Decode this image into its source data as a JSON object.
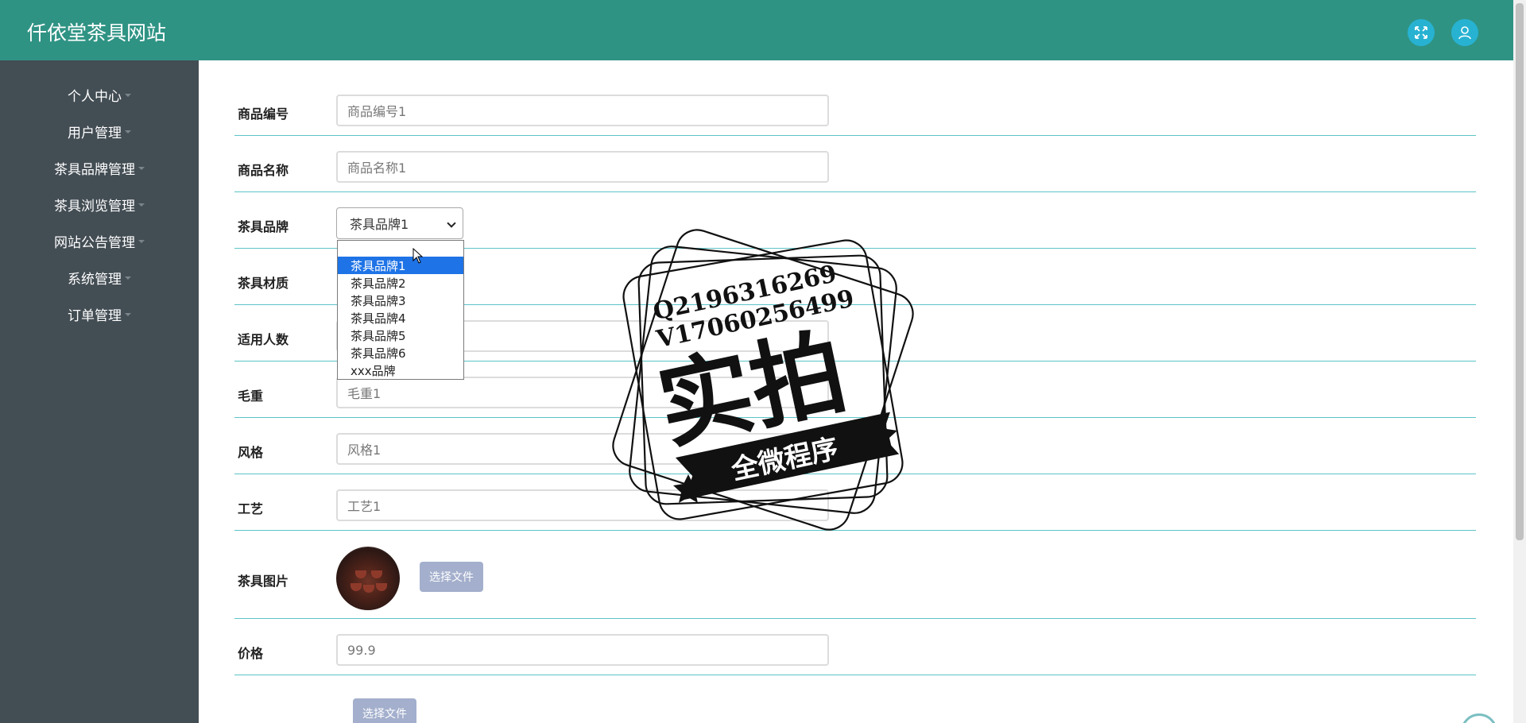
{
  "header": {
    "title": "仟依堂茶具网站",
    "icons": [
      "fullscreen-icon",
      "user-icon"
    ]
  },
  "sidebar": {
    "items": [
      {
        "label": "个人中心"
      },
      {
        "label": "用户管理"
      },
      {
        "label": "茶具品牌管理"
      },
      {
        "label": "茶具浏览管理"
      },
      {
        "label": "网站公告管理"
      },
      {
        "label": "系统管理"
      },
      {
        "label": "订单管理"
      }
    ]
  },
  "form": {
    "code": {
      "label": "商品编号",
      "value": "商品编号1"
    },
    "name": {
      "label": "商品名称",
      "value": "商品名称1"
    },
    "brand": {
      "label": "茶具品牌",
      "selected": "茶具品牌1",
      "options": [
        "茶具品牌1",
        "茶具品牌2",
        "茶具品牌3",
        "茶具品牌4",
        "茶具品牌5",
        "茶具品牌6",
        "xxx品牌"
      ]
    },
    "material": {
      "label": "茶具材质"
    },
    "people": {
      "label": "适用人数"
    },
    "weight": {
      "label": "毛重",
      "value": "毛重1"
    },
    "style": {
      "label": "风格",
      "value": "风格1"
    },
    "craft": {
      "label": "工艺",
      "value": "工艺1"
    },
    "image": {
      "label": "茶具图片",
      "button": "选择文件"
    },
    "price": {
      "label": "价格",
      "value": "99.9"
    },
    "upload2": {
      "button": "选择文件"
    }
  },
  "watermark": {
    "line1": "Q2196316269",
    "line2": "V17060256499",
    "main": "实拍",
    "banner": "全微程序"
  },
  "colors": {
    "header": "#2f9384",
    "sidebar": "#434d54",
    "accent": "#5cc3c7",
    "header_button": "#27b2d2",
    "select_highlight": "#1e73e6"
  }
}
